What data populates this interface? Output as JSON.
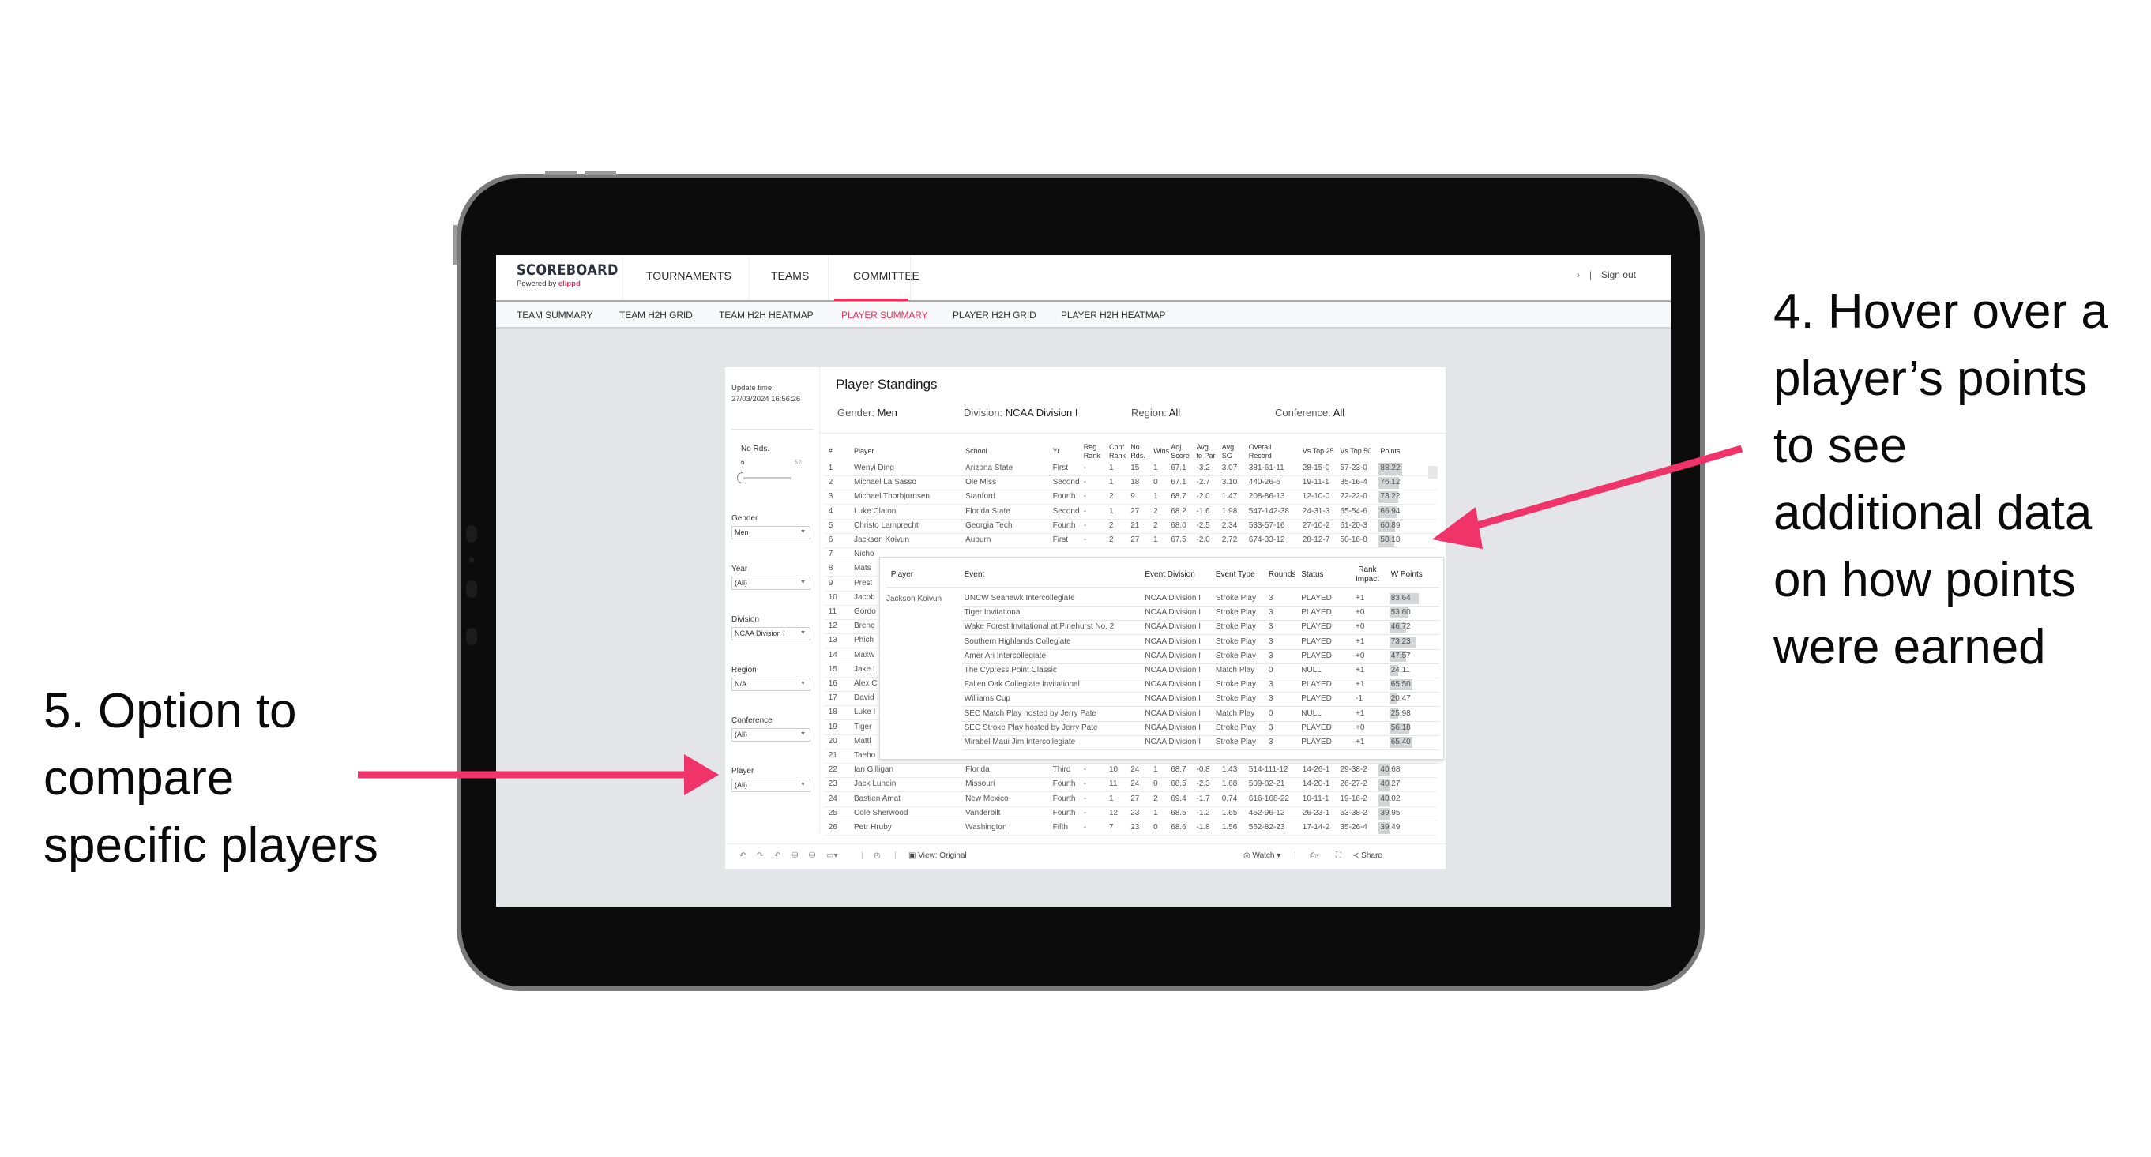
{
  "annotations": {
    "right_lines": [
      "4. Hover over a",
      "player’s points",
      "to see",
      "additional data",
      "on how points",
      "were earned"
    ],
    "left_lines": [
      "5. Option to",
      "compare",
      "specific players"
    ],
    "arrow_color": "#f0346a"
  },
  "app": {
    "logo": "SCOREBOARD",
    "powered_by": "Powered by",
    "brand": "clippd",
    "accent_color": "#e8325e",
    "nav": [
      "TOURNAMENTS",
      "TEAMS",
      "COMMITTEE"
    ],
    "nav_active": "COMMITTEE",
    "chevron": "›",
    "sign_out": "Sign out",
    "subnav": [
      "TEAM SUMMARY",
      "TEAM H2H GRID",
      "TEAM H2H HEATMAP",
      "PLAYER SUMMARY",
      "PLAYER H2H GRID",
      "PLAYER H2H HEATMAP"
    ],
    "subnav_active": "PLAYER SUMMARY"
  },
  "filters": {
    "update_label": "Update time:",
    "update_value": "27/03/2024 16:56:26",
    "no_rds_label": "No Rds.",
    "no_rds_min": "6",
    "no_rds_max": "52",
    "gender_label": "Gender",
    "gender_value": "Men",
    "year_label": "Year",
    "year_value": "(All)",
    "division_label": "Division",
    "division_value": "NCAA Division I",
    "region_label": "Region",
    "region_value": "N/A",
    "conference_label": "Conference",
    "conference_value": "(All)",
    "player_label": "Player",
    "player_value": "(All)"
  },
  "standings": {
    "title": "Player Standings",
    "criteria": [
      {
        "label": "Gender:",
        "value": "Men"
      },
      {
        "label": "Division:",
        "value": "NCAA Division I"
      },
      {
        "label": "Region:",
        "value": "All"
      },
      {
        "label": "Conference:",
        "value": "All"
      }
    ],
    "columns": [
      "#",
      "Player",
      "School",
      "Yr",
      "Reg Rank",
      "Conf Rank",
      "No Rds.",
      "Wins",
      "Adj. Score",
      "Avg. to Par",
      "Avg SG",
      "Overall Record",
      "Vs Top 25",
      "Vs Top 50",
      "Points"
    ],
    "rows": [
      [
        "1",
        "Wenyi Ding",
        "Arizona State",
        "First",
        "-",
        "1",
        "15",
        "1",
        "67.1",
        "-3.2",
        "3.07",
        "381-61-11",
        "28-15-0",
        "57-23-0",
        "88.22"
      ],
      [
        "2",
        "Michael La Sasso",
        "Ole Miss",
        "Second",
        "-",
        "1",
        "18",
        "0",
        "67.1",
        "-2.7",
        "3.10",
        "440-26-6",
        "19-11-1",
        "35-16-4",
        "76.12"
      ],
      [
        "3",
        "Michael Thorbjornsen",
        "Stanford",
        "Fourth",
        "-",
        "2",
        "9",
        "1",
        "68.7",
        "-2.0",
        "1.47",
        "208-86-13",
        "12-10-0",
        "22-22-0",
        "73.22"
      ],
      [
        "4",
        "Luke Claton",
        "Florida State",
        "Second",
        "-",
        "1",
        "27",
        "2",
        "68.2",
        "-1.6",
        "1.98",
        "547-142-38",
        "24-31-3",
        "65-54-6",
        "66.94"
      ],
      [
        "5",
        "Christo Lamprecht",
        "Georgia Tech",
        "Fourth",
        "-",
        "2",
        "21",
        "2",
        "68.0",
        "-2.5",
        "2.34",
        "533-57-16",
        "27-10-2",
        "61-20-3",
        "60.89"
      ],
      [
        "6",
        "Jackson Koivun",
        "Auburn",
        "First",
        "-",
        "2",
        "27",
        "1",
        "67.5",
        "-2.0",
        "2.72",
        "674-33-12",
        "28-12-7",
        "50-16-8",
        "58.18"
      ]
    ],
    "partial_rows": [
      [
        "7",
        "Nicho"
      ],
      [
        "8",
        "Mats"
      ],
      [
        "9",
        "Prest"
      ],
      [
        "10",
        "Jacob"
      ],
      [
        "11",
        "Gordo"
      ],
      [
        "12",
        "Brenc"
      ],
      [
        "13",
        "Phich"
      ],
      [
        "14",
        "Maxw"
      ],
      [
        "15",
        "Jake I"
      ],
      [
        "16",
        "Alex C"
      ],
      [
        "17",
        "David"
      ],
      [
        "18",
        "Luke I"
      ],
      [
        "19",
        "Tiger"
      ],
      [
        "20",
        "Mattl"
      ],
      [
        "21",
        "Taeho"
      ]
    ],
    "rows_after": [
      [
        "22",
        "Ian Gilligan",
        "Florida",
        "Third",
        "-",
        "10",
        "24",
        "1",
        "68.7",
        "-0.8",
        "1.43",
        "514-111-12",
        "14-26-1",
        "29-38-2",
        "40.68"
      ],
      [
        "23",
        "Jack Lundin",
        "Missouri",
        "Fourth",
        "-",
        "11",
        "24",
        "0",
        "68.5",
        "-2.3",
        "1.68",
        "509-82-21",
        "14-20-1",
        "26-27-2",
        "40.27"
      ],
      [
        "24",
        "Bastien Amat",
        "New Mexico",
        "Fourth",
        "-",
        "1",
        "27",
        "2",
        "69.4",
        "-1.7",
        "0.74",
        "616-168-22",
        "10-11-1",
        "19-16-2",
        "40.02"
      ],
      [
        "25",
        "Cole Sherwood",
        "Vanderbilt",
        "Fourth",
        "-",
        "12",
        "23",
        "1",
        "68.5",
        "-1.2",
        "1.65",
        "452-96-12",
        "26-23-1",
        "53-38-2",
        "39.95"
      ],
      [
        "26",
        "Petr Hruby",
        "Washington",
        "Fifth",
        "-",
        "7",
        "23",
        "0",
        "68.6",
        "-1.8",
        "1.56",
        "562-82-23",
        "17-14-2",
        "35-26-4",
        "39.49"
      ]
    ]
  },
  "tooltip": {
    "columns": [
      "Player",
      "Event",
      "Event Division",
      "Event Type",
      "Rounds",
      "Status",
      "Rank Impact",
      "W Points"
    ],
    "player": "Jackson Koivun",
    "rows": [
      [
        "UNCW Seahawk Intercollegiate",
        "NCAA Division I",
        "Stroke Play",
        "3",
        "PLAYED",
        "+1",
        "83.64"
      ],
      [
        "Tiger Invitational",
        "NCAA Division I",
        "Stroke Play",
        "3",
        "PLAYED",
        "+0",
        "53.60"
      ],
      [
        "Wake Forest Invitational at Pinehurst No. 2",
        "NCAA Division I",
        "Stroke Play",
        "3",
        "PLAYED",
        "+0",
        "46.72"
      ],
      [
        "Southern Highlands Collegiate",
        "NCAA Division I",
        "Stroke Play",
        "3",
        "PLAYED",
        "+1",
        "73.23"
      ],
      [
        "Amer Ari Intercollegiate",
        "NCAA Division I",
        "Stroke Play",
        "3",
        "PLAYED",
        "+0",
        "47.57"
      ],
      [
        "The Cypress Point Classic",
        "NCAA Division I",
        "Match Play",
        "0",
        "NULL",
        "+1",
        "24.11"
      ],
      [
        "Fallen Oak Collegiate Invitational",
        "NCAA Division I",
        "Stroke Play",
        "3",
        "PLAYED",
        "+1",
        "65.50"
      ],
      [
        "Williams Cup",
        "NCAA Division I",
        "Stroke Play",
        "3",
        "PLAYED",
        "-1",
        "20.47"
      ],
      [
        "SEC Match Play hosted by Jerry Pate",
        "NCAA Division I",
        "Match Play",
        "0",
        "NULL",
        "+1",
        "25.98"
      ],
      [
        "SEC Stroke Play hosted by Jerry Pate",
        "NCAA Division I",
        "Stroke Play",
        "3",
        "PLAYED",
        "+0",
        "56.18"
      ],
      [
        "Mirabel Maui Jim Intercollegiate",
        "NCAA Division I",
        "Stroke Play",
        "3",
        "PLAYED",
        "+1",
        "65.40"
      ]
    ]
  },
  "toolbar": {
    "view_label": "View: Original",
    "watch_label": "Watch",
    "share_label": "Share"
  }
}
